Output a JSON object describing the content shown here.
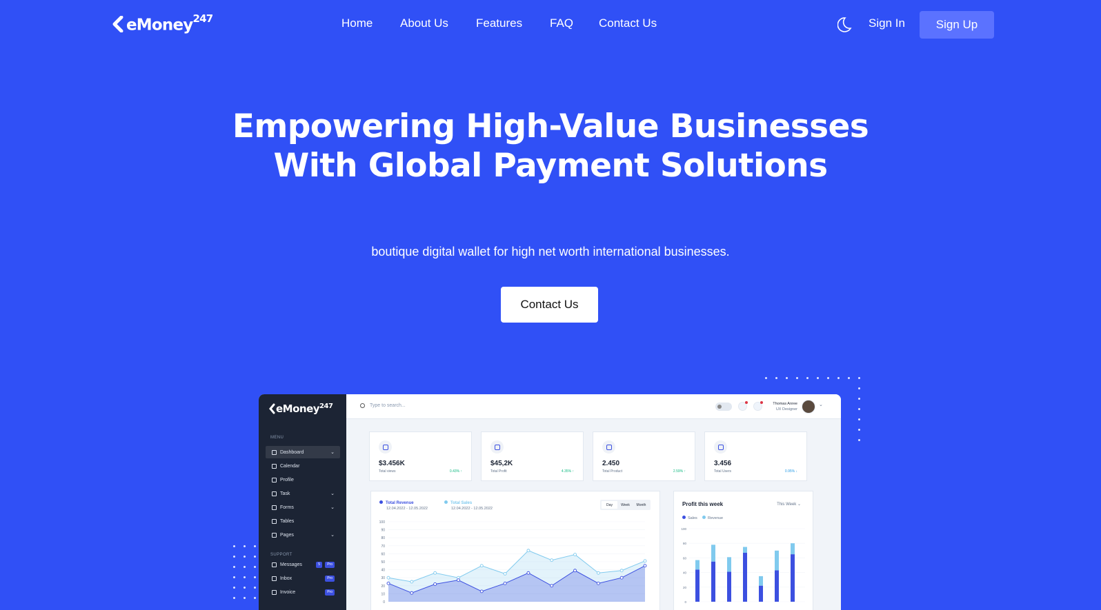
{
  "brand": {
    "name": "eMoney",
    "suffix": "247"
  },
  "nav": {
    "links": [
      {
        "label": "Home",
        "name": "nav-home"
      },
      {
        "label": "About Us",
        "name": "nav-about-us"
      },
      {
        "label": "Features",
        "name": "nav-features"
      },
      {
        "label": "FAQ",
        "name": "nav-faq"
      },
      {
        "label": "Contact Us",
        "name": "nav-contact-us"
      }
    ],
    "sign_in": "Sign In",
    "sign_up": "Sign Up",
    "theme_icon": "moon-icon"
  },
  "hero": {
    "title": "Empowering High-Value Businesses With Global Payment Solutions",
    "subtitle": "boutique digital wallet for high net worth international businesses.",
    "cta": "Contact Us"
  },
  "colors": {
    "background": "#3050f6",
    "signup_bg": "#5b72ff",
    "sidebar": "#1c2434",
    "primary": "#3c50e0",
    "secondary": "#80caee"
  },
  "dashboard": {
    "brand": {
      "name": "eMoney",
      "suffix": "247"
    },
    "sidebar": {
      "menu_heading": "MENU",
      "support_heading": "SUPPORT",
      "items": [
        {
          "label": "Dashboard",
          "caret": "⌄",
          "active": true
        },
        {
          "label": "Calendar"
        },
        {
          "label": "Profile"
        },
        {
          "label": "Task",
          "caret": "⌄"
        },
        {
          "label": "Forms",
          "caret": "⌄"
        },
        {
          "label": "Tables"
        },
        {
          "label": "Pages",
          "caret": "⌄"
        }
      ],
      "support_items": [
        {
          "label": "Messages",
          "badge": "5",
          "pro": "Pro"
        },
        {
          "label": "Inbox",
          "pro": "Pro"
        },
        {
          "label": "Invoice",
          "pro": "Pro"
        }
      ]
    },
    "topbar": {
      "search_placeholder": "Type to search...",
      "user_name": "Thomas Anree",
      "user_role": "UX Designer"
    },
    "cards": [
      {
        "value": "$3.456K",
        "label": "Total views",
        "change": "0.43% ↑",
        "trend": "up",
        "icon": "eye-icon"
      },
      {
        "value": "$45,2K",
        "label": "Total Profit",
        "change": "4.35% ↑",
        "trend": "up",
        "icon": "cart-icon"
      },
      {
        "value": "2.450",
        "label": "Total Product",
        "change": "2.59% ↑",
        "trend": "up",
        "icon": "bag-icon"
      },
      {
        "value": "3.456",
        "label": "Total Users",
        "change": "0.95% ↓",
        "trend": "down",
        "icon": "users-icon"
      }
    ],
    "revenue_chart": {
      "legend": [
        {
          "name": "Total Revenue",
          "range": "12.04.2022 - 12.05.2022"
        },
        {
          "name": "Total Sales",
          "range": "12.04.2022 - 12.05.2022"
        }
      ],
      "periods": [
        "Day",
        "Week",
        "Month"
      ]
    },
    "profit_chart": {
      "title": "Profit this week",
      "period": "This Week",
      "legend": [
        "Sales",
        "Revenue"
      ]
    }
  },
  "chart_data": [
    {
      "type": "area",
      "ylim": [
        0,
        100
      ],
      "yticks": [
        0,
        10,
        20,
        30,
        40,
        50,
        60,
        70,
        80,
        90,
        100
      ],
      "series": [
        {
          "name": "Total Revenue",
          "values": [
            23,
            11,
            22,
            27,
            13,
            23,
            36,
            20,
            39,
            23,
            30,
            45
          ]
        },
        {
          "name": "Total Sales",
          "values": [
            30,
            25,
            36,
            30,
            45,
            35,
            64,
            52,
            59,
            36,
            39,
            51
          ]
        }
      ]
    },
    {
      "type": "bar",
      "ylim": [
        0,
        100
      ],
      "yticks": [
        0,
        20,
        40,
        60,
        80,
        100
      ],
      "series": [
        {
          "name": "Sales",
          "values": [
            44,
            55,
            41,
            67,
            22,
            43,
            65
          ]
        },
        {
          "name": "Revenue",
          "values": [
            13,
            23,
            20,
            8,
            13,
            27,
            15
          ]
        }
      ]
    }
  ]
}
